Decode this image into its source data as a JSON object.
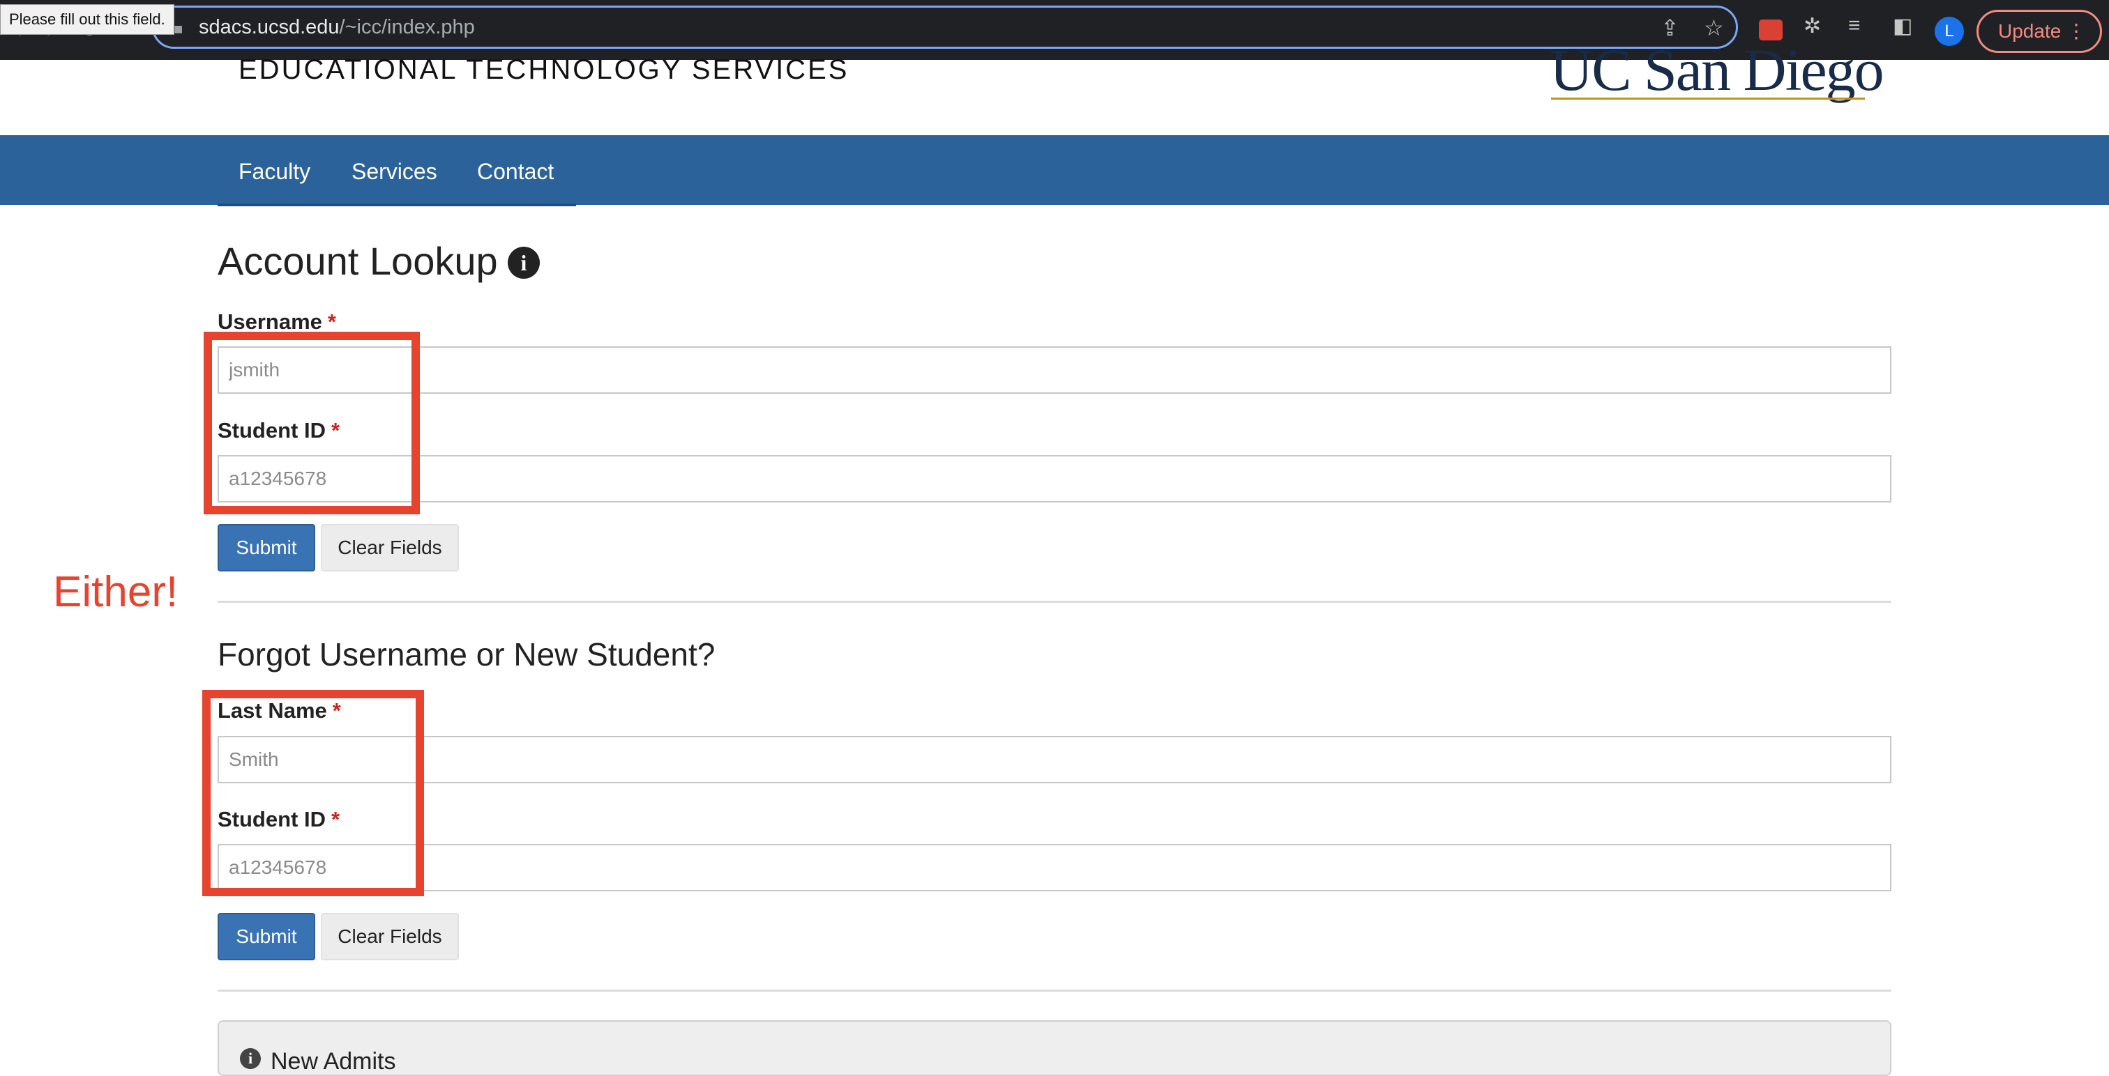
{
  "browser": {
    "tooltip": "Please fill out this field.",
    "url_host": "sdacs.ucsd.edu",
    "url_path": "/~icc/index.php",
    "avatar_letter": "L",
    "update_label": "Update",
    "icons": [
      "back-icon",
      "forward-icon",
      "reload-icon",
      "lock-icon",
      "share-icon",
      "bookmark-star-icon",
      "todoist-icon",
      "extensions-icon",
      "reading-list-icon",
      "side-panel-icon",
      "menu-icon"
    ]
  },
  "header": {
    "title": "EDUCATIONAL TECHNOLOGY SERVICES",
    "logo_text": "UC San Diego"
  },
  "nav": {
    "items": [
      {
        "label": "Faculty"
      },
      {
        "label": "Services"
      },
      {
        "label": "Contact"
      }
    ]
  },
  "account_lookup": {
    "heading": "Account Lookup",
    "username_label": "Username",
    "username_placeholder": "jsmith",
    "student_id_label": "Student ID",
    "student_id_placeholder": "a12345678",
    "submit_label": "Submit",
    "clear_label": "Clear Fields"
  },
  "forgot": {
    "heading": "Forgot Username or New Student?",
    "last_name_label": "Last Name",
    "last_name_placeholder": "Smith",
    "student_id_label": "Student ID",
    "student_id_placeholder": "a12345678",
    "submit_label": "Submit",
    "clear_label": "Clear Fields"
  },
  "required_marker": "*",
  "annotation": {
    "text": "Either!",
    "color": "#e8432e"
  },
  "new_admits": {
    "title": "New Admits"
  },
  "colors": {
    "nav_bar": "#2b6299",
    "submit_button": "#3a73b4",
    "required": "#d0211c"
  }
}
